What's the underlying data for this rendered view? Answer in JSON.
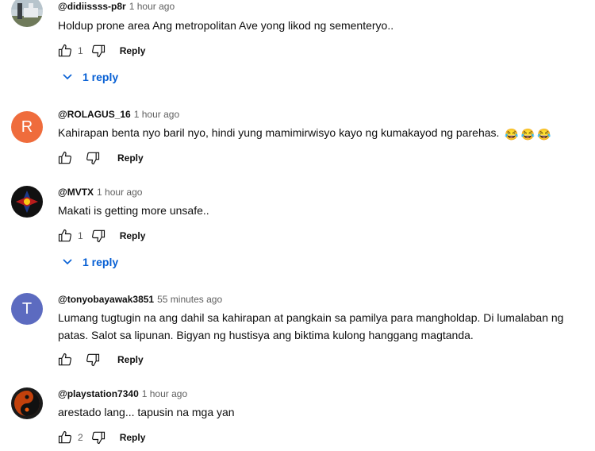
{
  "comments": [
    {
      "author": "@didiissss-p8r",
      "time": "1 hour ago",
      "text": "Holdup prone area Ang metropolitan Ave yong likod ng sementeryo..",
      "likes": "1",
      "reply_label": "Reply",
      "replies_label": "1 reply",
      "avatar": {
        "type": "photo",
        "icon": "monument-photo-avatar"
      }
    },
    {
      "author": "@ROLAGUS_16",
      "time": "1 hour ago",
      "text": "Kahirapan benta nyo baril nyo, hindi yung mamimirwisyo kayo ng kumakayod ng parehas.",
      "emojis": [
        "😂",
        "😂",
        "😂"
      ],
      "likes": "",
      "reply_label": "Reply",
      "avatar": {
        "type": "letter",
        "letter": "R",
        "color": "#ef6c3c"
      }
    },
    {
      "author": "@MVTX",
      "time": "1 hour ago",
      "text": "Makati is getting more unsafe..",
      "likes": "1",
      "reply_label": "Reply",
      "replies_label": "1 reply",
      "avatar": {
        "type": "photo",
        "icon": "flag-emblem-avatar"
      }
    },
    {
      "author": "@tonyobayawak3851",
      "time": "55 minutes ago",
      "text": "Lumang tugtugin na ang dahil sa kahirapan at pangkain sa pamilya para mangholdap. Di lumalaban ng patas. Salot sa lipunan. Bigyan ng hustisya ang biktima kulong hanggang magtanda.",
      "likes": "",
      "reply_label": "Reply",
      "avatar": {
        "type": "letter",
        "letter": "T",
        "color": "#5c6bc0"
      }
    },
    {
      "author": "@playstation7340",
      "time": "1 hour ago",
      "text": "arestado lang... tapusin na mga yan",
      "likes": "2",
      "reply_label": "Reply",
      "avatar": {
        "type": "photo",
        "icon": "yin-yang-avatar"
      }
    }
  ],
  "colors": {
    "link": "#065fd4",
    "meta": "#606060",
    "text": "#0f0f0f"
  }
}
